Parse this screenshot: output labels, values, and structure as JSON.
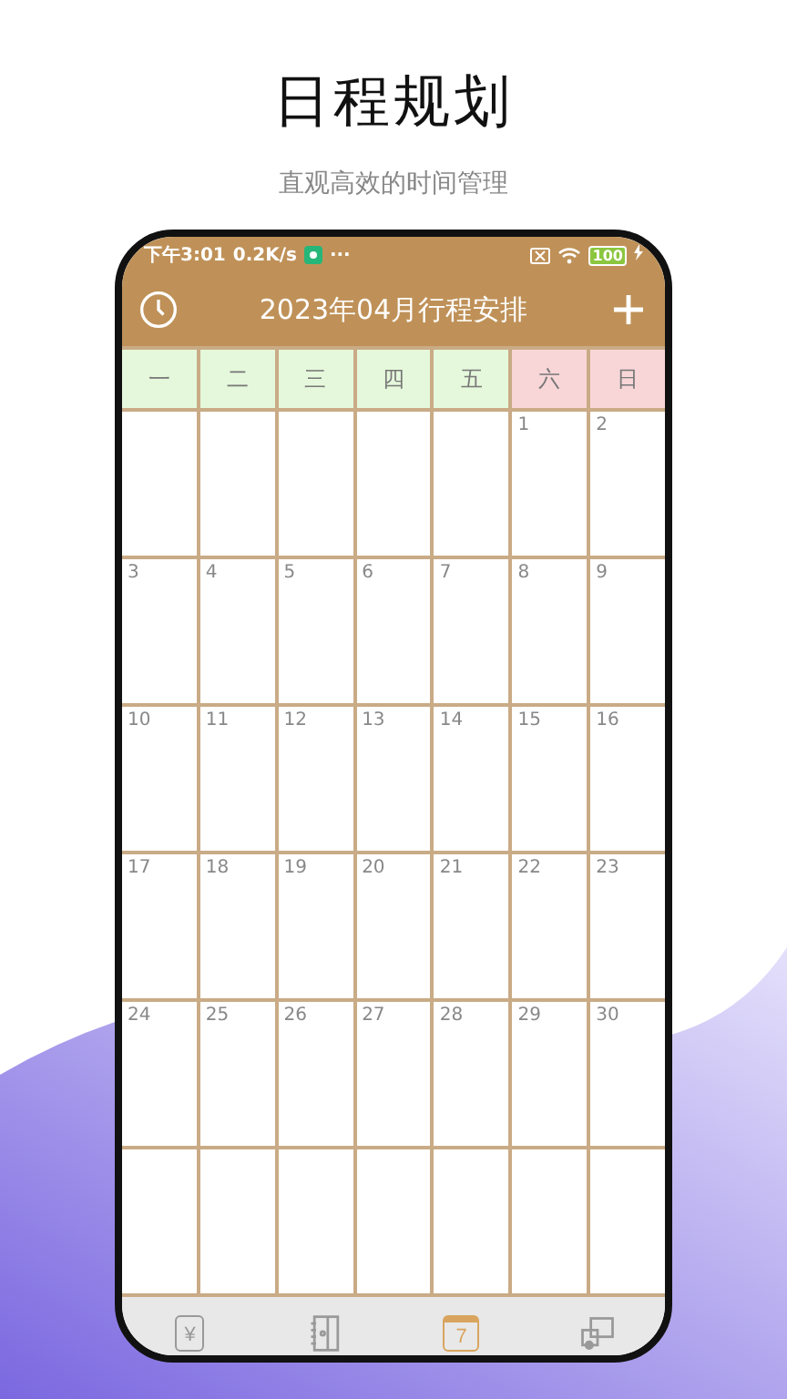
{
  "headline": "日程规划",
  "subtitle": "直观高效的时间管理",
  "status_bar": {
    "time": "下午3:01",
    "speed": "0.2K/s",
    "more": "···",
    "battery": "100"
  },
  "header": {
    "title": "2023年04月行程安排"
  },
  "weekdays": [
    {
      "label": "一",
      "color": "#e5f8db"
    },
    {
      "label": "二",
      "color": "#e5f8db"
    },
    {
      "label": "三",
      "color": "#e5f8db"
    },
    {
      "label": "四",
      "color": "#e5f8db"
    },
    {
      "label": "五",
      "color": "#e5f8db"
    },
    {
      "label": "六",
      "color": "#f8d6d8"
    },
    {
      "label": "日",
      "color": "#f8d6d8"
    }
  ],
  "weeks": [
    [
      {
        "kind": "blank"
      },
      {
        "kind": "blank"
      },
      {
        "kind": "blank"
      },
      {
        "kind": "blank"
      },
      {
        "kind": "blank"
      },
      {
        "kind": "day",
        "label": "1"
      },
      {
        "kind": "day",
        "label": "2"
      }
    ],
    [
      {
        "kind": "day",
        "label": "3"
      },
      {
        "kind": "day",
        "label": "4"
      },
      {
        "kind": "day",
        "label": "5"
      },
      {
        "kind": "day",
        "label": "6"
      },
      {
        "kind": "day",
        "label": "7"
      },
      {
        "kind": "day",
        "label": "8"
      },
      {
        "kind": "day",
        "label": "9"
      }
    ],
    [
      {
        "kind": "day",
        "label": "10"
      },
      {
        "kind": "day",
        "label": "11"
      },
      {
        "kind": "day",
        "label": "12"
      },
      {
        "kind": "day",
        "label": "13"
      },
      {
        "kind": "day",
        "label": "14"
      },
      {
        "kind": "day",
        "label": "15"
      },
      {
        "kind": "day",
        "label": "16"
      }
    ],
    [
      {
        "kind": "day",
        "label": "17"
      },
      {
        "kind": "day",
        "label": "18"
      },
      {
        "kind": "day",
        "label": "19"
      },
      {
        "kind": "day",
        "label": "20"
      },
      {
        "kind": "day",
        "label": "21"
      },
      {
        "kind": "day",
        "label": "22"
      },
      {
        "kind": "day",
        "label": "23"
      }
    ],
    [
      {
        "kind": "day",
        "label": "24"
      },
      {
        "kind": "day",
        "label": "25"
      },
      {
        "kind": "day",
        "label": "26"
      },
      {
        "kind": "day",
        "label": "27"
      },
      {
        "kind": "day",
        "label": "28"
      },
      {
        "kind": "day",
        "label": "29"
      },
      {
        "kind": "day",
        "label": "30"
      }
    ],
    [
      {
        "kind": "blank"
      },
      {
        "kind": "blank"
      },
      {
        "kind": "blank"
      },
      {
        "kind": "blank"
      },
      {
        "kind": "blank"
      },
      {
        "kind": "blank"
      },
      {
        "kind": "blank"
      }
    ]
  ],
  "tab_bar": [
    {
      "kind": "wallet",
      "text": "¥",
      "selected": false
    },
    {
      "kind": "notebook",
      "selected": false
    },
    {
      "kind": "calendar",
      "text": "7",
      "selected": true
    },
    {
      "kind": "computer",
      "selected": false
    }
  ]
}
